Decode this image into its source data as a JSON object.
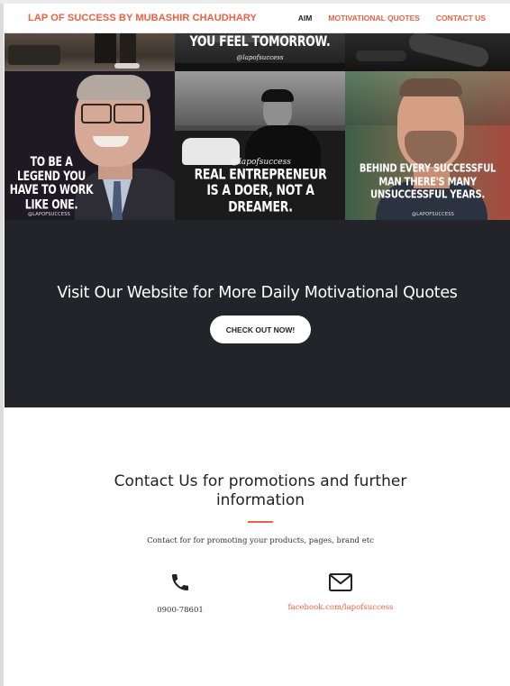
{
  "navbar": {
    "brand": "LAP OF SUCCESS BY MUBASHIR CHAUDHARY",
    "links": [
      "AIM",
      "MOTIVATIONAL QUOTES",
      "CONTACT US"
    ]
  },
  "portfolio": {
    "tile_top_middle": {
      "caption": "YOU FEEL TOMORROW.",
      "handle": "@lapofsuccess"
    },
    "tile_bill_gates": {
      "caption": "TO BE A LEGEND YOU HAVE TO WORK LIKE ONE.",
      "handle": "@LAPOFSUCCESS"
    },
    "tile_entrepreneur": {
      "handle": "@lapofsuccess",
      "caption": "REAL ENTREPRENEUR IS A DOER, NOT A DREAMER."
    },
    "tile_tom_hardy": {
      "caption": "BEHIND EVERY SUCCESSFUL MAN THERE'S MANY UNSUCCESSFUL YEARS.",
      "handle": "@LAPOFSUCCESS"
    }
  },
  "cta": {
    "title": "Visit Our Website for More Daily Motivational Quotes",
    "button": "CHECK OUT NOW!"
  },
  "contact": {
    "title": "Contact Us for promotions and further information",
    "subtitle": "Contact for for promoting your products, pages, brand etc",
    "phone": "0900-78601",
    "facebook": "facebook.com/lapofsuccess"
  },
  "colors": {
    "accent": "#f05f40",
    "dark_section": "#222429",
    "text_dark": "#222222"
  },
  "icons": [
    "phone-icon",
    "envelope-icon"
  ]
}
